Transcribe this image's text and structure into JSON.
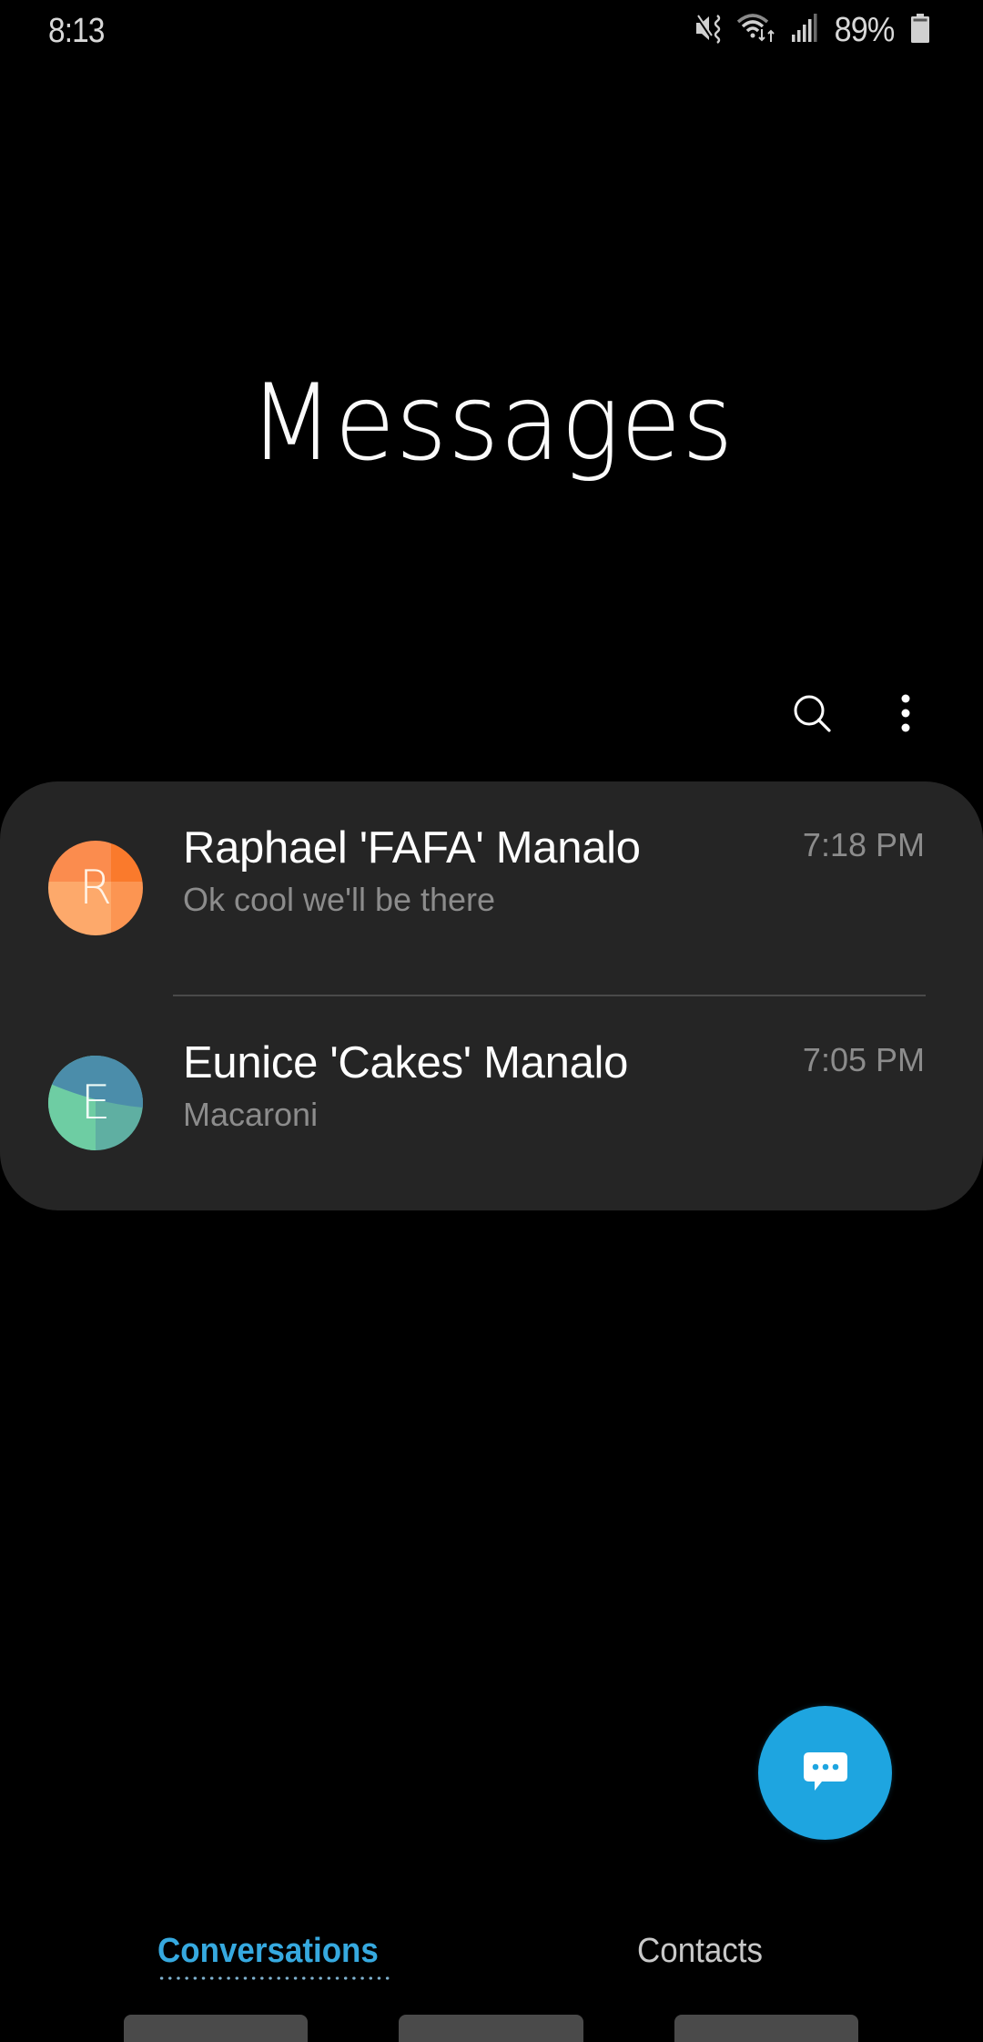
{
  "status_bar": {
    "time": "8:13",
    "battery_percent": "89%",
    "icons": [
      "vibrate-mute-icon",
      "wifi-icon",
      "signal-icon",
      "battery-icon"
    ]
  },
  "header": {
    "title": "Messages",
    "actions": [
      {
        "name": "search",
        "icon": "search-icon"
      },
      {
        "name": "more-options",
        "icon": "more-vertical-icon"
      }
    ]
  },
  "conversations": [
    {
      "avatar_letter": "R",
      "avatar_colors": [
        "#FB8C4E",
        "#FA7A2C",
        "#FDA96B",
        "#FC9552"
      ],
      "name": "Raphael 'FAFA' Manalo",
      "preview": "Ok cool we'll be there",
      "time": "7:18 PM"
    },
    {
      "avatar_letter": "E",
      "avatar_colors": [
        "#4B8DAA",
        "#6ECDA3",
        "#5FAFA2"
      ],
      "name": "Eunice 'Cakes' Manalo",
      "preview": "Macaroni",
      "time": "7:05 PM"
    }
  ],
  "fab": {
    "icon": "new-message-icon",
    "accent": "#1EA5E0"
  },
  "tabs": [
    {
      "label": "Conversations",
      "active": true
    },
    {
      "label": "Contacts",
      "active": false
    }
  ],
  "colors": {
    "background": "#000000",
    "card": "#252525",
    "accent": "#36A9DF",
    "secondary_text": "#8C8C8C"
  }
}
